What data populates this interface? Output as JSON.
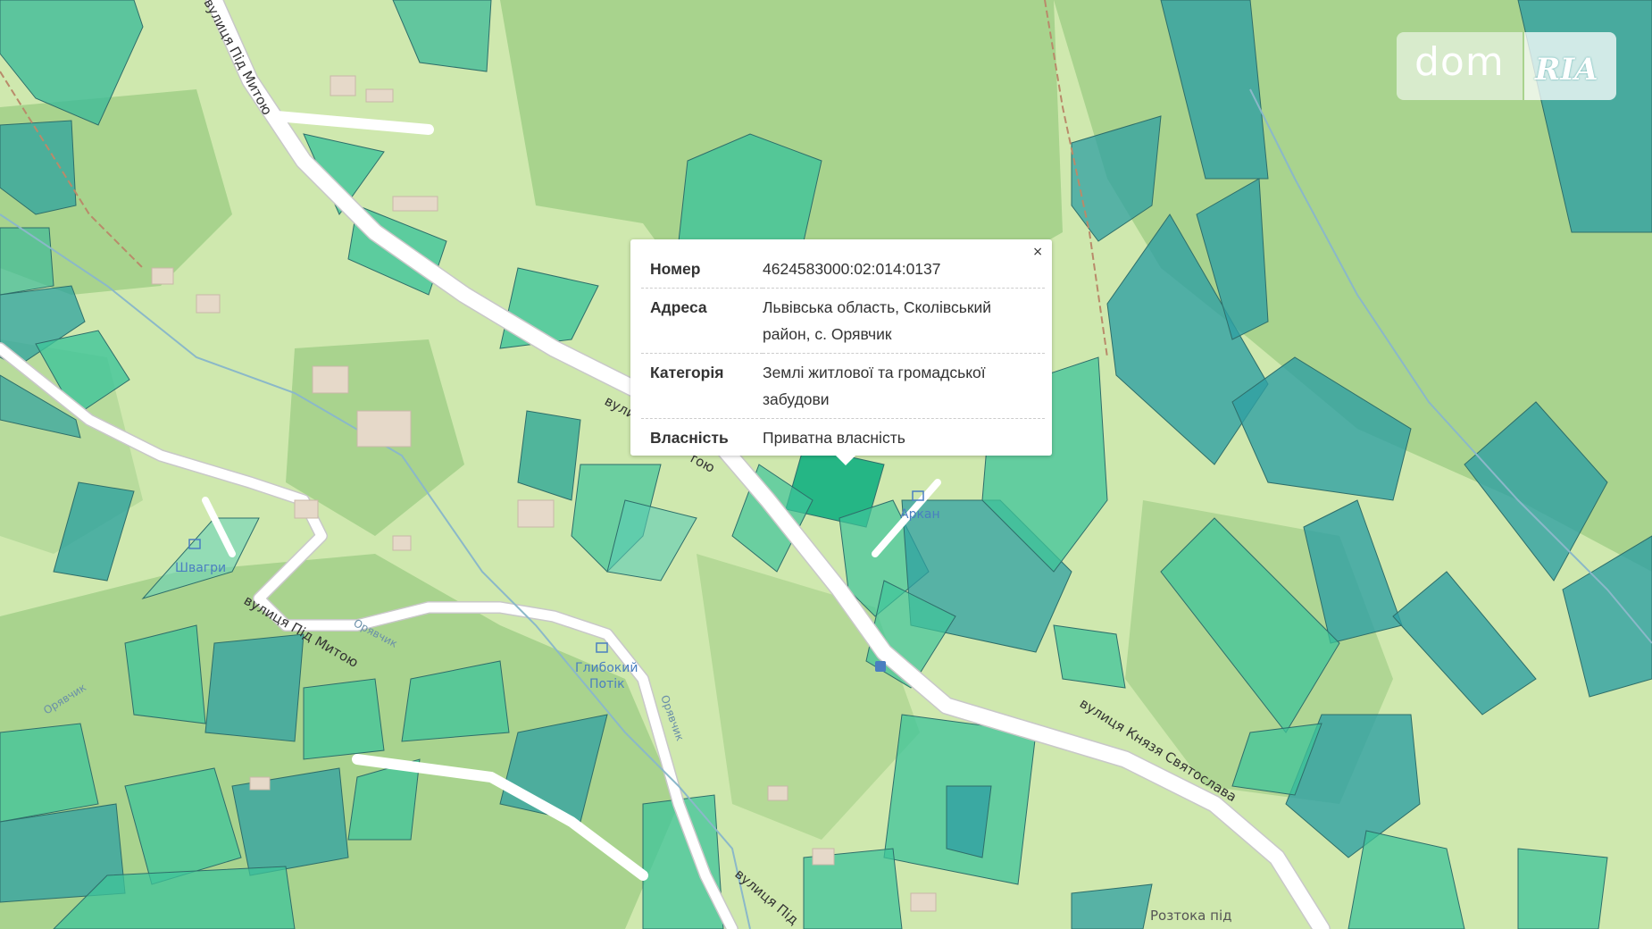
{
  "streets": {
    "pid_mytoyu_top": "вулиця Під Митою",
    "pid_mytoyu_mid_a": "вули",
    "pid_mytoyu_mid_b": "тою",
    "pid_mytoyu_left": "вулиця Під Митою",
    "knyazia_sviatoslava": "вулиця Князя Святослава",
    "pid_bottom": "вулиця Під"
  },
  "water": {
    "oriavchyk_1": "Орявчик",
    "oriavchyk_2": "Орявчик",
    "oriavchyk_3": "Орявчик"
  },
  "poi": {
    "shvahry": "Швагри",
    "arkan": "Аркан",
    "hlybokyi_potik_1": "Глибокий",
    "hlybokyi_potik_2": "Потік"
  },
  "places": {
    "roztoka": "Розтока під"
  },
  "popup": {
    "rows": [
      {
        "key": "Номер",
        "value": "4624583000:02:014:0137"
      },
      {
        "key": "Адреса",
        "value": "Львівська область, Сколівський район, с. Орявчик"
      },
      {
        "key": "Категорія",
        "value": "Землі житлової та громадської забудови"
      },
      {
        "key": "Власність",
        "value": "Приватна власність"
      }
    ],
    "close": "×"
  },
  "logo": {
    "dom": "dom",
    "ria": "RIA"
  },
  "colors": {
    "meadow": "#cfe8ae",
    "forest": "#a9d38e",
    "parcel": "#3fb997",
    "parcel_dark": "#2f9f9a",
    "road": "#ffffff",
    "selected_parcel": "#25b685"
  }
}
